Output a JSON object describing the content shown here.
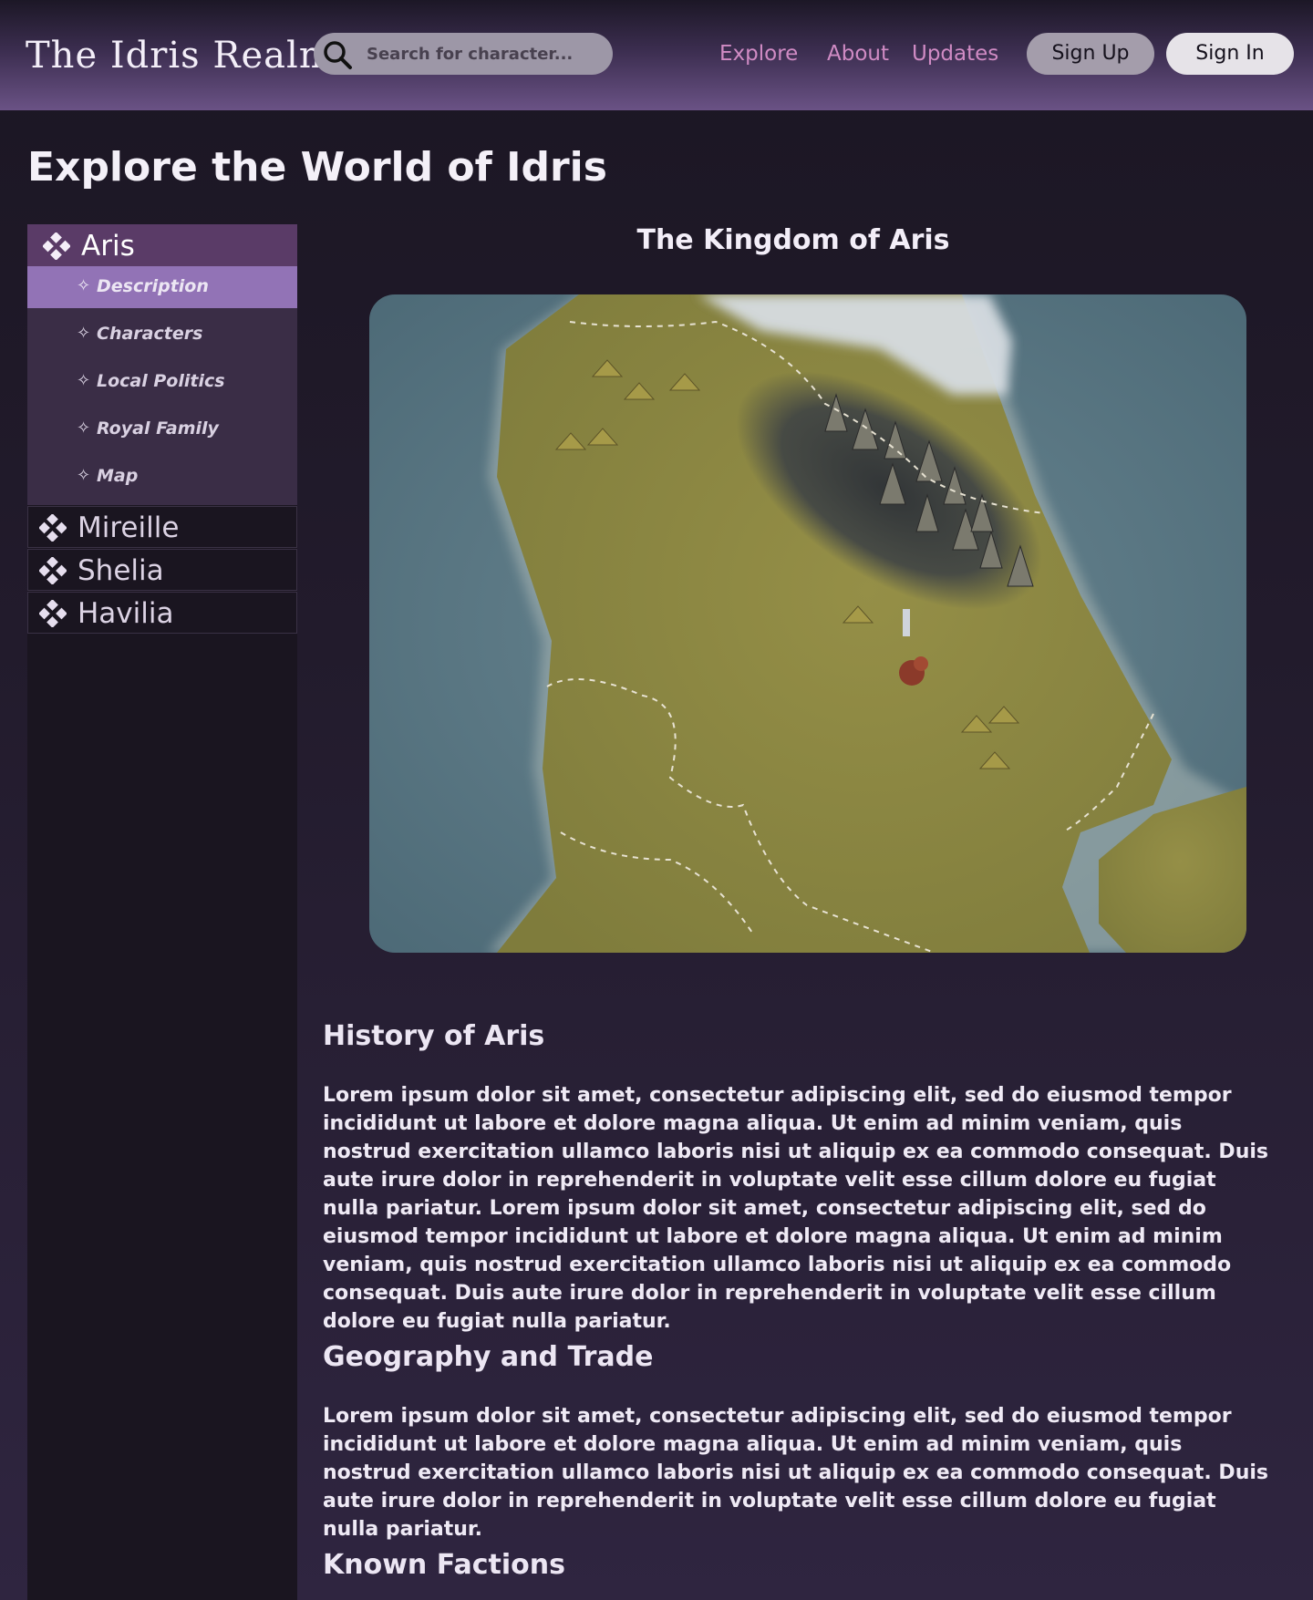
{
  "header": {
    "logo": "The Idris Realm",
    "search_placeholder": "Search for character...",
    "nav": [
      "Explore",
      "About",
      "Updates"
    ],
    "signup_label": "Sign Up",
    "signin_label": "Sign In"
  },
  "page_title": "Explore the World of Idris",
  "sidebar": {
    "regions": [
      {
        "label": "Aris",
        "active": true
      },
      {
        "label": "Mireille"
      },
      {
        "label": "Shelia"
      },
      {
        "label": "Havilia"
      }
    ],
    "subitems": [
      {
        "label": "Description",
        "selected": true
      },
      {
        "label": "Characters"
      },
      {
        "label": "Local Politics"
      },
      {
        "label": "Royal Family"
      },
      {
        "label": "Map"
      }
    ],
    "sub_icon_glyph": "✧"
  },
  "main": {
    "kingdom_title": "The Kingdom of Aris",
    "sections": [
      {
        "heading": "History of Aris",
        "body": "Lorem ipsum dolor sit amet, consectetur adipiscing elit, sed do eiusmod tempor incididunt ut labore et dolore magna aliqua. Ut enim ad minim veniam, quis nostrud exercitation ullamco laboris nisi ut aliquip ex ea commodo consequat. Duis aute irure dolor in reprehenderit in voluptate velit esse cillum dolore eu fugiat nulla pariatur. Lorem ipsum dolor sit amet, consectetur adipiscing elit, sed do eiusmod tempor incididunt ut labore et dolore magna aliqua. Ut enim ad minim veniam, quis nostrud exercitation ullamco laboris nisi ut aliquip ex ea commodo consequat. Duis aute irure dolor in reprehenderit in voluptate velit esse cillum dolore eu fugiat nulla pariatur."
      },
      {
        "heading": "Geography and Trade",
        "body": "Lorem ipsum dolor sit amet, consectetur adipiscing elit, sed do eiusmod tempor incididunt ut labore et dolore magna aliqua. Ut enim ad minim veniam, quis nostrud exercitation ullamco laboris nisi ut aliquip ex ea commodo consequat. Duis aute irure dolor in reprehenderit in voluptate velit esse cillum dolore eu fugiat nulla pariatur."
      },
      {
        "heading": "Known Factions"
      }
    ]
  },
  "colors": {
    "accent_link": "#d08bc4",
    "active_region": "#5a3b67",
    "selected_subitem": "#9273b6",
    "map_sea": "#5d7b87",
    "map_land": "#8d8a45"
  },
  "icons": {
    "search": "search-icon",
    "region": "diamond-icon",
    "subitem": "sparkle-icon"
  }
}
